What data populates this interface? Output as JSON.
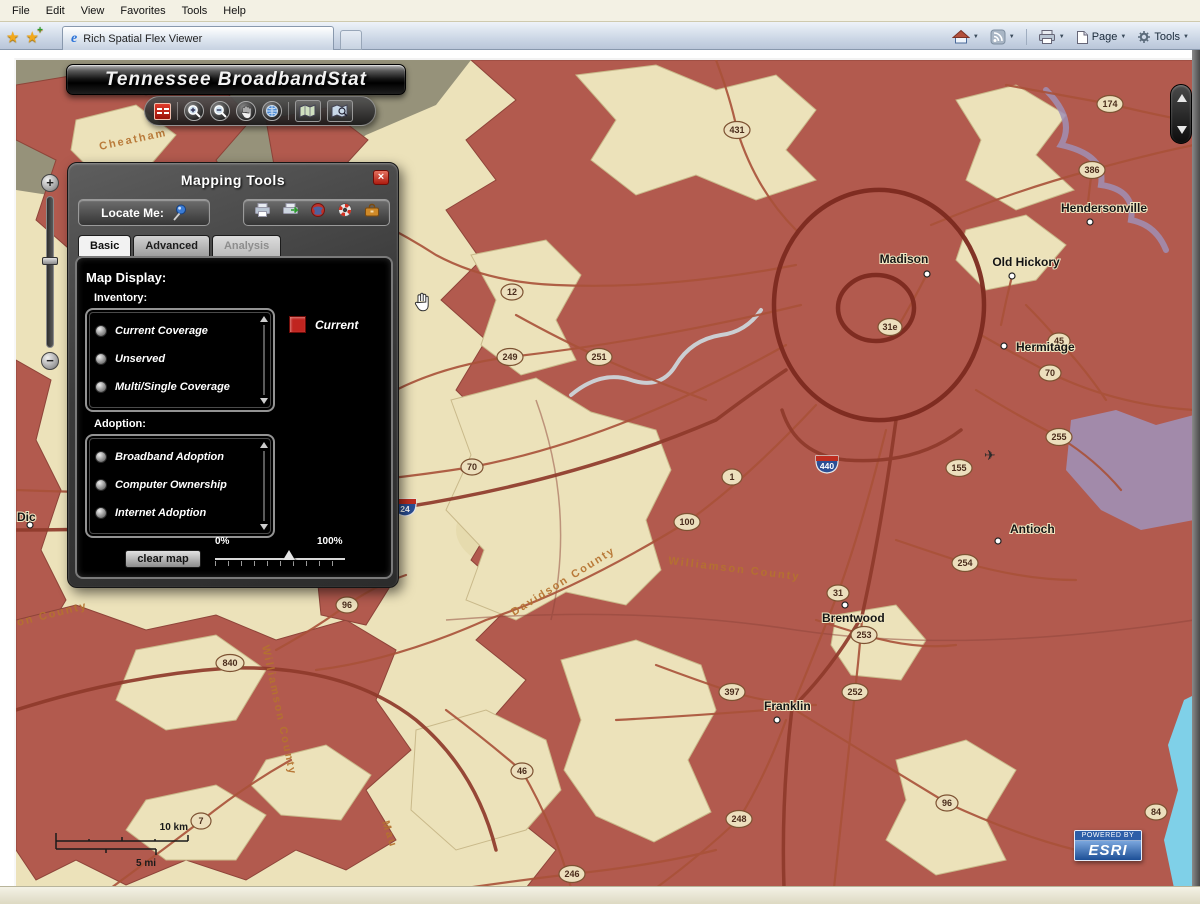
{
  "icons": {
    "star": "★",
    "plus": "+",
    "caret": "▼",
    "close": "×",
    "plane": "✈",
    "ie_e": "e",
    "zoom_in": "+",
    "zoom_out": "−"
  },
  "browser": {
    "menu_items": [
      "File",
      "Edit",
      "View",
      "Favorites",
      "Tools",
      "Help"
    ],
    "tab_title": "Rich Spatial Flex Viewer",
    "page_label": "Page",
    "tools_label": "Tools"
  },
  "app": {
    "banner_title": "Tennessee BroadbandStat"
  },
  "panel": {
    "title": "Mapping Tools",
    "locate_me": "Locate Me:",
    "tab_basic": "Basic",
    "tab_advanced": "Advanced",
    "tab_analysis": "Analysis",
    "map_display": "Map Display:",
    "inventory_label": "Inventory:",
    "inventory_options": [
      "Current Coverage",
      "Unserved",
      "Multi/Single Coverage"
    ],
    "legend_label": "Current",
    "legend_color": "#c0241f",
    "adoption_label": "Adoption:",
    "adoption_options": [
      "Broadband Adoption",
      "Computer Ownership",
      "Internet Adoption"
    ],
    "clear_map": "clear map",
    "slider_min": "0%",
    "slider_max": "100%"
  },
  "map": {
    "coverage_color": "#b25a4e",
    "base_color": "#ece2ba",
    "cities": [
      "Madison",
      "Old Hickory",
      "Hendersonville",
      "Hermitage",
      "Antioch",
      "Brentwood",
      "Franklin",
      "Dic"
    ],
    "counties": [
      "Davidson County",
      "Williamson County",
      "Williamson County",
      "on County",
      "Cheatham",
      "Mau"
    ],
    "shields": [
      "431",
      "174",
      "386",
      "12",
      "31e",
      "45",
      "70",
      "249",
      "251",
      "255",
      "155",
      "70",
      "1",
      "100",
      "254",
      "31",
      "253",
      "96",
      "840",
      "397",
      "252",
      "46",
      "96",
      "248",
      "246",
      "7",
      "84"
    ],
    "interstates": [
      "440",
      "24"
    ],
    "scale_km": "10 km",
    "scale_mi": "5 mi",
    "esri_powered": "POWERED BY",
    "esri_name": "ESRI"
  }
}
